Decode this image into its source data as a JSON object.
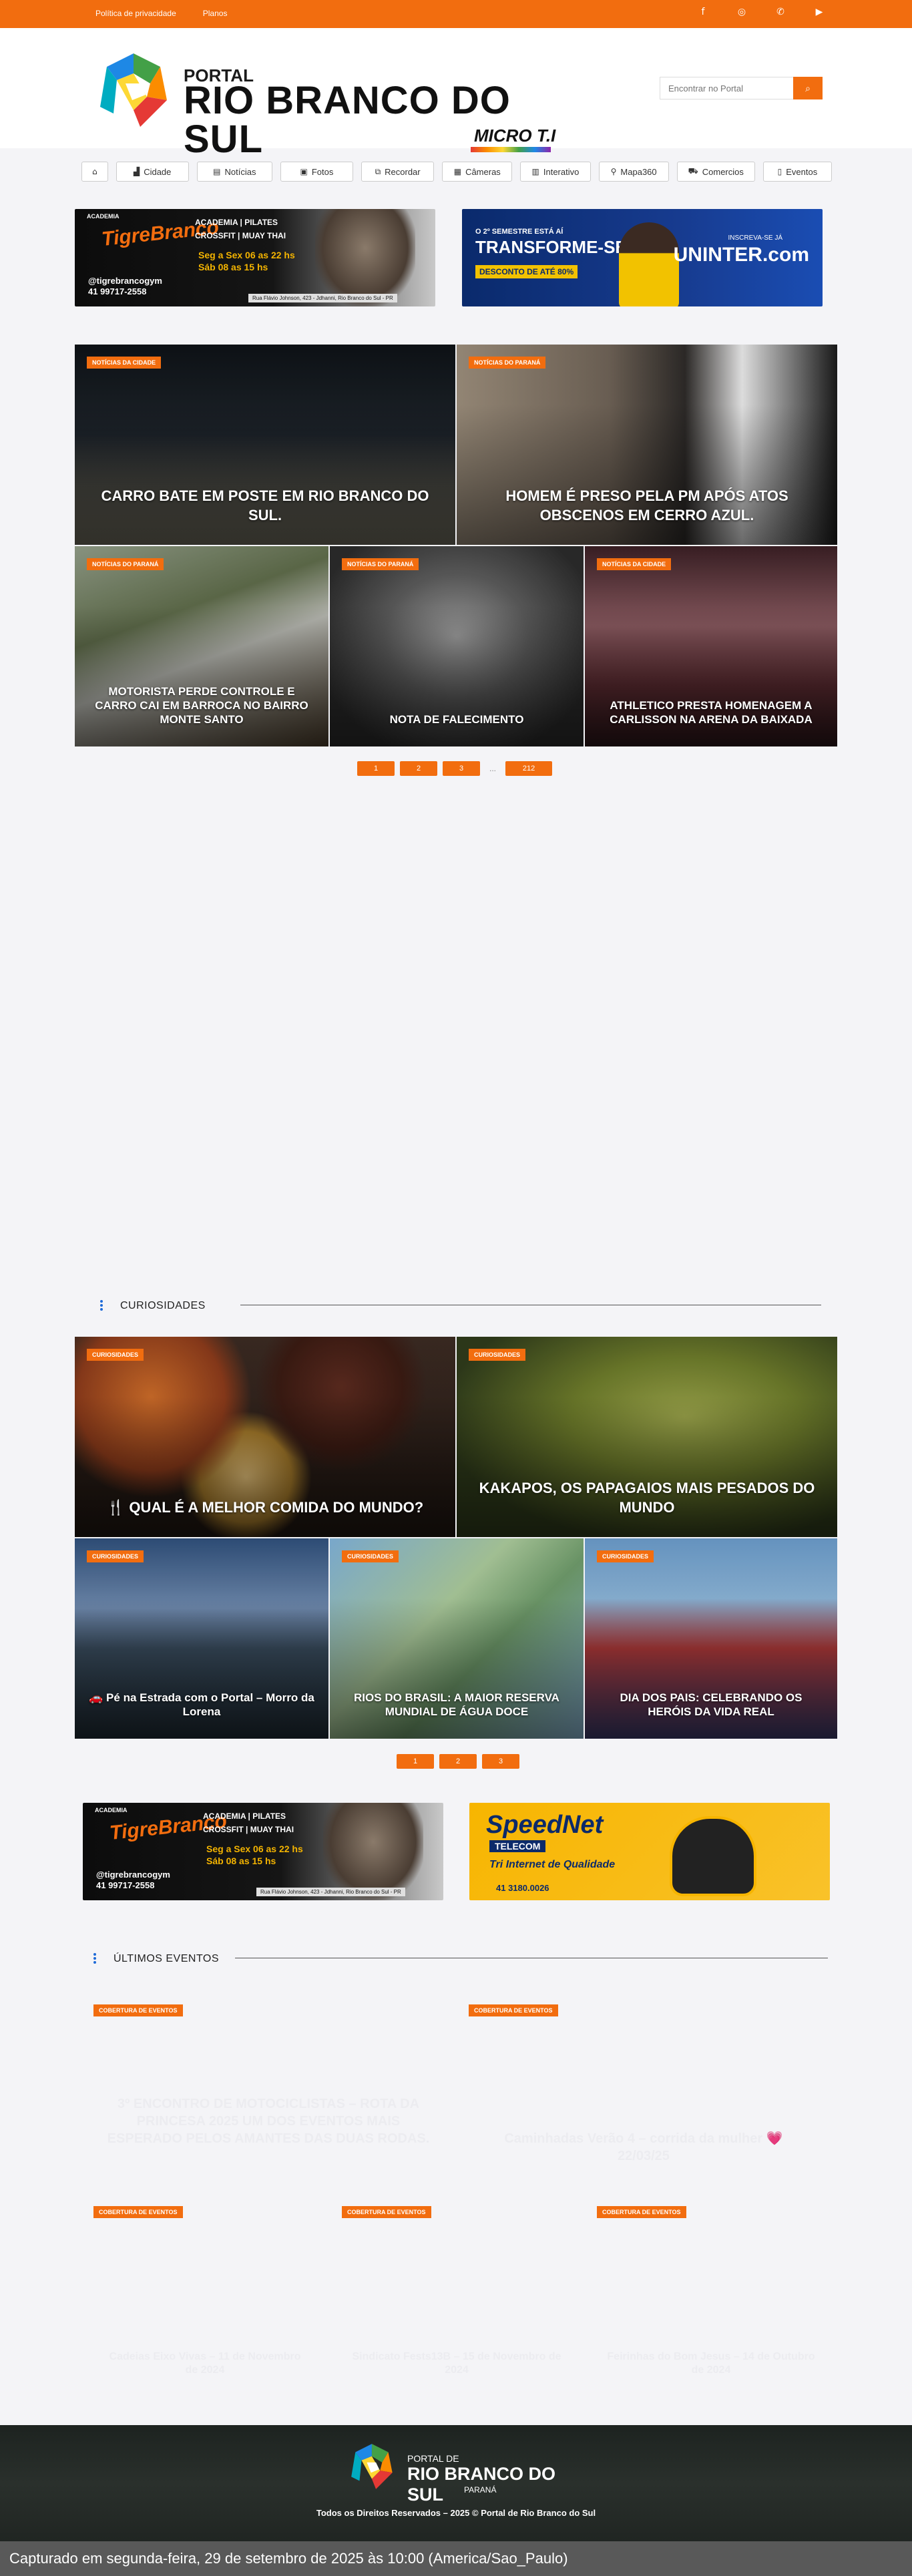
{
  "topbar": {
    "links": [
      "Política de privacidade",
      "Planos"
    ],
    "social_icons": [
      "facebook-icon",
      "instagram-icon",
      "whatsapp-icon",
      "youtube-icon"
    ]
  },
  "brand": {
    "small": "PORTAL",
    "big": "RIO BRANCO DO SUL",
    "micro": "MICRO T.I"
  },
  "search": {
    "placeholder": "Encontrar no Portal"
  },
  "nav": [
    {
      "label": "",
      "icon": "home-icon"
    },
    {
      "label": "Cidade",
      "icon": "city-icon"
    },
    {
      "label": "Notícias",
      "icon": "newspaper-icon"
    },
    {
      "label": "Fotos",
      "icon": "photo-icon"
    },
    {
      "label": "Recordar",
      "icon": "images-icon"
    },
    {
      "label": "Câmeras",
      "icon": "camera-icon"
    },
    {
      "label": "Interativo",
      "icon": "chart-icon"
    },
    {
      "label": "Mapa360",
      "icon": "map-marker-icon"
    },
    {
      "label": "Comercios",
      "icon": "cart-icon"
    },
    {
      "label": "Eventos",
      "icon": "book-icon"
    }
  ],
  "ads": {
    "tigre": {
      "brand_top": "ACADEMIA",
      "brand": "TigreBranco",
      "services": "ACADEMIA | PILATES\nCROSSFIT | MUAY THAI",
      "hours": "Seg a Sex 06 as 22 hs\nSáb 08 as 15 hs",
      "contact": "@tigrebrancogym\n41 99717-2558",
      "address": "Rua Flávio Johnson, 423 - Jdhanni, Rio Branco do Sul - PR"
    },
    "uninter": {
      "top": "O 2º SEMESTRE ESTÁ AÍ",
      "headline": "TRANSFORME-SE",
      "offer": "DESCONTO DE ATÉ 80%",
      "cta": "INSCREVA-SE JÁ",
      "brand": "UNINTER.com"
    },
    "speednet": {
      "brand": "SpeedNet",
      "sub": "TELECOM",
      "tagline": "Tri Internet de Qualidade",
      "phone": "41 3180.0026"
    }
  },
  "news": [
    {
      "category": "Notícias da Cidade",
      "title": "CARRO BATE EM POSTE EM RIO BRANCO DO SUL."
    },
    {
      "category": "Notícias do Paraná",
      "title": "HOMEM É PRESO PELA PM APÓS ATOS OBSCENOS EM CERRO AZUL."
    },
    {
      "category": "Notícias do Paraná",
      "title": "MOTORISTA PERDE CONTROLE E CARRO CAI EM BARROCA NO BAIRRO MONTE SANTO"
    },
    {
      "category": "Notícias do Paraná",
      "title": "NOTA DE FALECIMENTO"
    },
    {
      "category": "Notícias da Cidade",
      "title": "ATHLETICO PRESTA HOMENAGEM A CARLISSON NA ARENA DA BAIXADA"
    }
  ],
  "news_pager": [
    "1",
    "2",
    "3",
    "...",
    "212"
  ],
  "curiosidades": {
    "heading": "CURIOSIDADES",
    "items": [
      {
        "category": "Curiosidades",
        "title": "🍴 QUAL É A MELHOR COMIDA DO MUNDO?"
      },
      {
        "category": "Curiosidades",
        "title": "KAKAPOS, OS PAPAGAIOS MAIS PESADOS DO MUNDO"
      },
      {
        "category": "Curiosidades",
        "title": "🚗 Pé na Estrada com o Portal – Morro da Lorena"
      },
      {
        "category": "Curiosidades",
        "title": "RIOS DO BRASIL: A MAIOR RESERVA MUNDIAL DE ÁGUA DOCE"
      },
      {
        "category": "Curiosidades",
        "title": "DIA DOS PAIS: CELEBRANDO OS HERÓIS DA VIDA REAL"
      }
    ],
    "pager": [
      "1",
      "2",
      "3"
    ]
  },
  "eventos": {
    "heading": "ÚLTIMOS EVENTOS",
    "items": [
      {
        "category": "Cobertura de Eventos",
        "title": "3º ENCONTRO DE MOTOCICLISTAS – ROTA DA PRINCESA 2025 UM DOS EVENTOS MAIS ESPERADO PELOS AMANTES DAS DUAS RODAS."
      },
      {
        "category": "Cobertura de Eventos",
        "title": "Caminhadas Verão 4 – corrida da mulher 💗 22/03/25"
      },
      {
        "category": "Cobertura de Eventos",
        "title": "Cadeias Eixo Vivas – 11 de Novembro de 2024"
      },
      {
        "category": "Cobertura de Eventos",
        "title": "Sindicato Fests13B – 15 de Novembro de 2024"
      },
      {
        "category": "Cobertura de Eventos",
        "title": "Feirinhas do Bom Jesus – 14 de Outubro de 2024"
      }
    ]
  },
  "footer": {
    "portal": "PORTAL DE",
    "name": "RIO BRANCO DO SUL",
    "state": "PARANÁ",
    "copyright": "Todos os Direitos Reservados – 2025 © Portal de Rio Branco do Sul"
  },
  "captured": "Capturado em segunda-feira, 29 de setembro de 2025 às 10:00 (America/Sao_Paulo)",
  "colors": {
    "accent": "#f26d0f",
    "section_dots": "#1e6ad8"
  }
}
